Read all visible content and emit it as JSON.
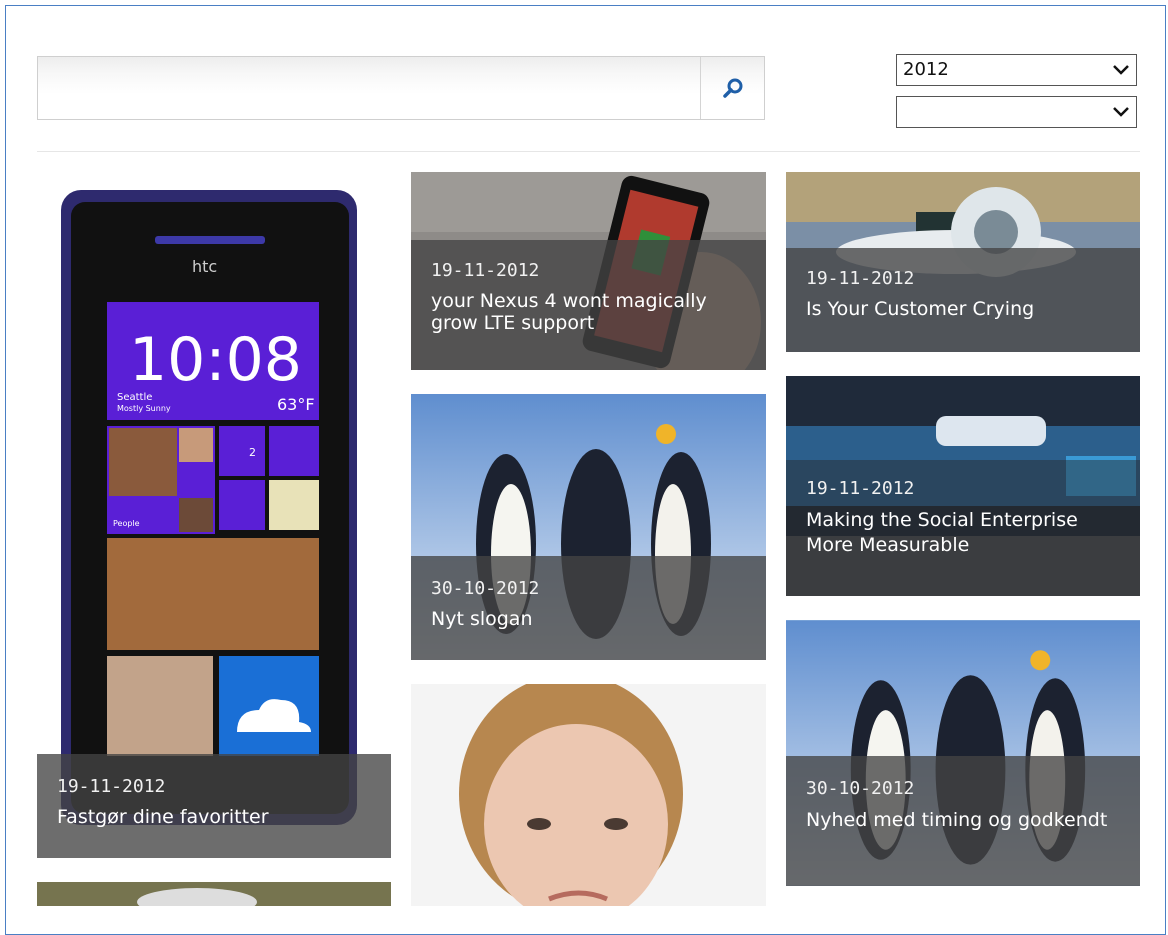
{
  "search": {
    "value": "",
    "placeholder": "",
    "button_icon": "search-icon"
  },
  "filters": {
    "year": "2012",
    "month": ""
  },
  "colors": {
    "frame_border": "#4a7fc4",
    "search_icon": "#1f5fa8",
    "caption_bg": "#444444"
  },
  "tiles": [
    {
      "date": "19-11-2012",
      "title": "Fastgør dine favoritter"
    },
    {
      "date": "19-11-2012",
      "title": "your Nexus 4 wont magically grow LTE support"
    },
    {
      "date": "19-11-2012",
      "title": "Is Your Customer Crying"
    },
    {
      "date": "30-10-2012",
      "title": "Nyt slogan"
    },
    {
      "date": "19-11-2012",
      "title": "Making the Social Enterprise More Measurable"
    },
    {
      "date": "30-10-2012",
      "title": "Nyhed med timing og godkendt"
    }
  ],
  "phone": {
    "brand": "htc",
    "time": "10:08",
    "city": "Seattle",
    "weather": "Mostly Sunny",
    "temp": "63°F",
    "people_label": "People",
    "message_count": "2"
  }
}
